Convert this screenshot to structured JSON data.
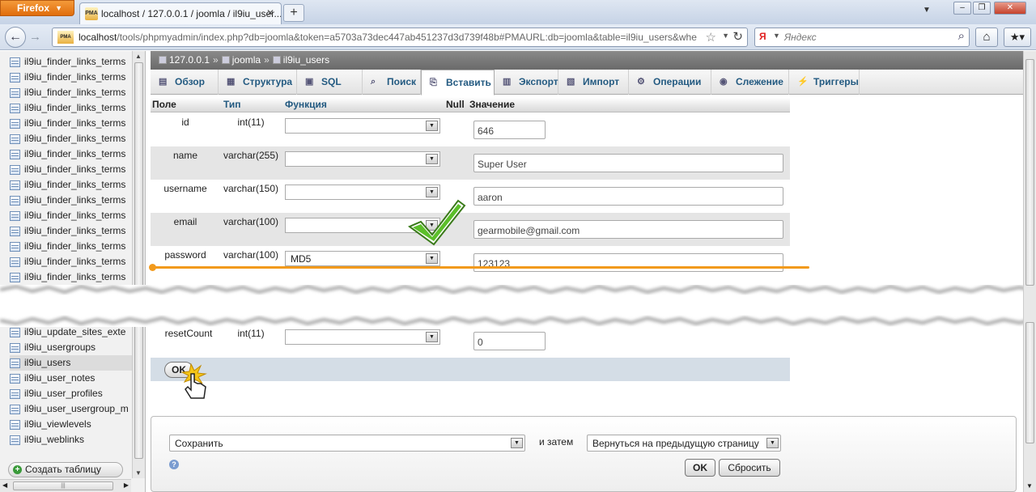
{
  "browser": {
    "app_button": "Firefox",
    "tab_title": "localhost / 127.0.0.1 / joomla / il9iu_user...",
    "url_host": "localhost",
    "url_rest": "/tools/phpmyadmin/index.php?db=joomla&token=a5703a73dec447ab451237d3d739f48b#PMAURL:db=joomla&table=il9iu_users&whe",
    "search_placeholder": "Яндекс"
  },
  "sidebar": {
    "items_top": [
      "il9iu_finder_links_terms",
      "il9iu_finder_links_terms",
      "il9iu_finder_links_terms",
      "il9iu_finder_links_terms",
      "il9iu_finder_links_terms",
      "il9iu_finder_links_terms",
      "il9iu_finder_links_terms",
      "il9iu_finder_links_terms",
      "il9iu_finder_links_terms",
      "il9iu_finder_links_terms",
      "il9iu_finder_links_terms",
      "il9iu_finder_links_terms",
      "il9iu_finder_links_terms",
      "il9iu_finder_links_terms",
      "il9iu_finder_links_terms"
    ],
    "items_bottom": [
      "il9iu_update_sites_exte",
      "il9iu_usergroups",
      "il9iu_users",
      "il9iu_user_notes",
      "il9iu_user_profiles",
      "il9iu_user_usergroup_m",
      "il9iu_viewlevels",
      "il9iu_weblinks"
    ],
    "active_item": "il9iu_users",
    "create_table": "Создать таблицу"
  },
  "breadcrumb": {
    "server": "127.0.0.1",
    "database": "joomla",
    "table": "il9iu_users"
  },
  "tabs": [
    {
      "label": "Обзор",
      "icon": "browse-icon"
    },
    {
      "label": "Структура",
      "icon": "structure-icon"
    },
    {
      "label": "SQL",
      "icon": "sql-icon"
    },
    {
      "label": "Поиск",
      "icon": "search-icon"
    },
    {
      "label": "Вставить",
      "icon": "insert-icon",
      "active": true
    },
    {
      "label": "Экспорт",
      "icon": "export-icon"
    },
    {
      "label": "Импорт",
      "icon": "import-icon"
    },
    {
      "label": "Операции",
      "icon": "operations-icon"
    },
    {
      "label": "Слежение",
      "icon": "tracking-icon"
    },
    {
      "label": "Триггеры",
      "icon": "triggers-icon"
    }
  ],
  "table_header": {
    "field": "Поле",
    "type": "Тип",
    "function": "Функция",
    "null": "Null",
    "value": "Значение"
  },
  "rows": [
    {
      "name": "id",
      "type": "int(11)",
      "function": "",
      "value": "646"
    },
    {
      "name": "name",
      "type": "varchar(255)",
      "function": "",
      "value": "Super User"
    },
    {
      "name": "username",
      "type": "varchar(150)",
      "function": "",
      "value": "aaron"
    },
    {
      "name": "email",
      "type": "varchar(100)",
      "function": "",
      "value": "gearmobile@gmail.com"
    },
    {
      "name": "password",
      "type": "varchar(100)",
      "function": "MD5",
      "value": "123123"
    }
  ],
  "last_row": {
    "name": "resetCount",
    "type": "int(11)",
    "function": "",
    "value": "0"
  },
  "ok_label": "OK",
  "bottom": {
    "action": "Сохранить",
    "and_then": "и затем",
    "after": "Вернуться на предыдущую страницу",
    "ok": "OK",
    "reset": "Сбросить"
  },
  "colors": {
    "accent_link": "#235a81",
    "highlight_line": "#f29a1c",
    "checkmark": "#5cbf2a"
  }
}
